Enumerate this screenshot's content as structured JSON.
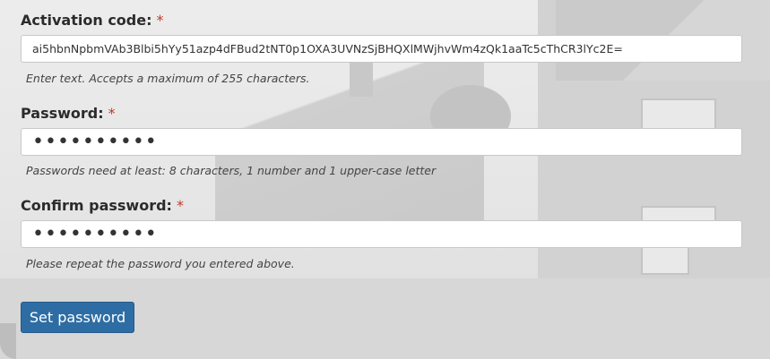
{
  "activation": {
    "label": "Activation code:",
    "required_mark": "*",
    "value": "ai5hbnNpbmVAb3Blbi5hYy51azp4dFBud2tNT0p1OXA3UVNzSjBHQXlMWjhvWm4zQk1aaTc5cThCR3lYc2E=",
    "help": "Enter text. Accepts a maximum of 255 characters."
  },
  "password": {
    "label": "Password:",
    "required_mark": "*",
    "masked_value": "••••••••••",
    "help": "Passwords need at least: 8 characters, 1 number and 1 upper-case letter"
  },
  "confirm": {
    "label": "Confirm password:",
    "required_mark": "*",
    "masked_value": "••••••••••",
    "help": "Please repeat the password you entered above."
  },
  "submit": {
    "label": "Set password"
  },
  "colors": {
    "button": "#2e6da4",
    "required": "#c0392b"
  }
}
